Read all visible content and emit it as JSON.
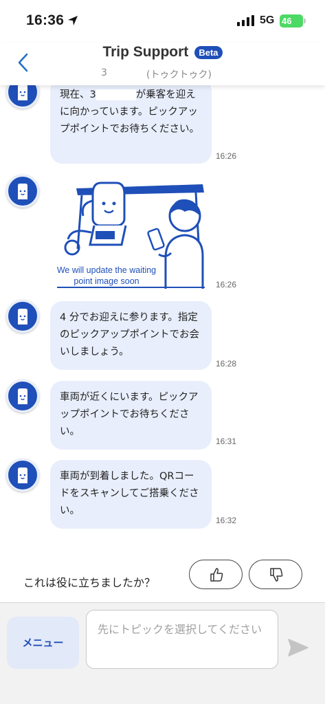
{
  "status_bar": {
    "time": "16:36",
    "network": "5G",
    "battery": "46"
  },
  "header": {
    "title": "Trip Support",
    "badge": "Beta",
    "subtitle_left": "3",
    "subtitle_right": "(トゥクトゥク)"
  },
  "messages": [
    {
      "text_before": "現在、3",
      "text_after": "が乗客を迎えに向かっています。ピックアップポイントでお待ちください。",
      "time": "16:26"
    },
    {
      "image_caption_line1": "We will update the waiting",
      "image_caption_line2": "point image soon",
      "time": "16:26"
    },
    {
      "text": "4 分でお迎えに参ります。指定のピックアップポイントでお会いしましょう。",
      "time": "16:28"
    },
    {
      "text": "車両が近くにいます。ピックアップポイントでお待ちください。",
      "time": "16:31"
    },
    {
      "text": "車両が到着しました。QRコードをスキャンしてご搭乗ください。",
      "time": "16:32"
    }
  ],
  "feedback": {
    "question": "これは役に立ちましたか？"
  },
  "composer": {
    "menu_label": "メニュー",
    "placeholder": "先にトピックを選択してください"
  },
  "colors": {
    "brand": "#1f4fb8",
    "bubble": "#e8eefb",
    "battery": "#4cd964"
  },
  "icons": {
    "back": "chevron-left-icon",
    "send": "send-icon",
    "thumb_up": "thumbs-up-icon",
    "thumb_down": "thumbs-down-icon"
  }
}
